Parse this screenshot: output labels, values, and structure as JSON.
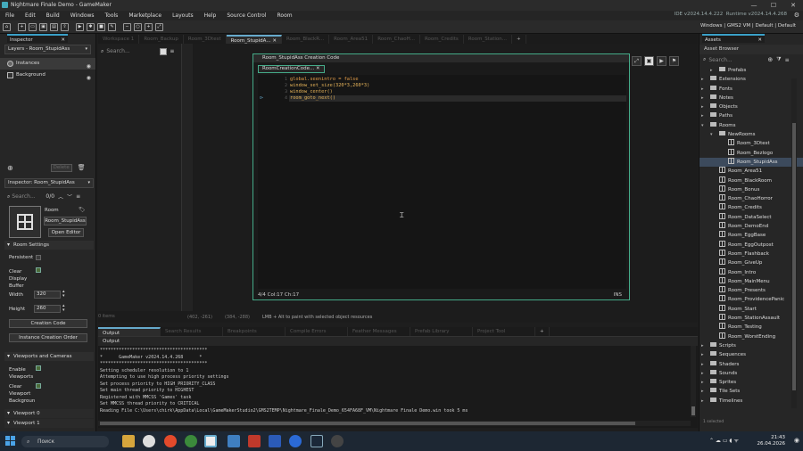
{
  "window": {
    "title": "Nightmare Finale Demo - GameMaker",
    "ide_version": "IDE v2024.14.4.222",
    "runtime_version": "Runtime v2024.14.4.268"
  },
  "menu": [
    "File",
    "Edit",
    "Build",
    "Windows",
    "Tools",
    "Marketplace",
    "Layouts",
    "Help",
    "Source Control",
    "Room"
  ],
  "toolbar": {
    "target": "Windows | GMS2 VM | Default | Default"
  },
  "inspector": {
    "tab": "Inspector",
    "layers_title": "Layers - Room_StupidAss",
    "layers": [
      "Instances",
      "Background"
    ],
    "delete_label": "Delete",
    "inspector_select": "Inspector: Room_StupidAss",
    "search_placeholder": "Search...",
    "search_count": "0/0",
    "room_label": "Room",
    "room_name": "Room_StupidAss",
    "open_editor": "Open Editor",
    "room_settings": "Room Settings",
    "persistent": "Persistent",
    "clear_display_buffer": "Clear Display Buffer",
    "width_label": "Width",
    "width_value": "320",
    "height_label": "Height",
    "height_value": "260",
    "creation_code": "Creation Code",
    "instance_creation_order": "Instance Creation Order",
    "viewports": "Viewports and Cameras",
    "enable_viewports": "Enable Viewports",
    "clear_viewport_bg": "Clear Viewport Backgroun",
    "viewport0": "Viewport 0",
    "viewport1": "Viewport 1"
  },
  "editor_tabs": [
    "Workspace 1",
    "Room_Backup",
    "Room_3Dtest",
    "Room_StupidA...",
    "Room_BlackR...",
    "Room_Area51",
    "Room_ChaoH...",
    "Room_Credits",
    "Room_Station..."
  ],
  "room_tree": {
    "search_placeholder": "Search...",
    "instances": "0 items"
  },
  "code_editor": {
    "window_title": "Room_StupidAss Creation Code",
    "tab": "RoomCreationCode...",
    "lines": [
      "global.seenintro = false",
      "window_set_size(320*3,260*3)",
      "window_center()",
      "room_goto_next()"
    ],
    "status_pos": "4/4 Col:17 Ch:17",
    "status_mode": "INS"
  },
  "workspace_status": {
    "mouse": "(402, -261)",
    "grid": "(384, -288)",
    "hint": "LMB + Alt to paint with selected object resources"
  },
  "output_tabs": [
    "Output",
    "Search Results",
    "Breakpoints",
    "Compile Errors",
    "Feather Messages",
    "Prefab Library",
    "Project Tool"
  ],
  "output": {
    "header": "Output",
    "lines": [
      "****************************************",
      "*      GameMaker v2024.14.4.268      *",
      "****************************************",
      "Setting scheduler resolution to 1",
      "Attempting to use high process priority settings",
      "Set process priority to HIGH_PRIORITY_CLASS",
      "Set main thread priority to HIGHEST",
      "Registered with MMCSS 'Games' task",
      "Set MMCSS thread priority to CRITICAL",
      "Reading File C:\\Users\\chirk\\AppData\\Local\\GameMakerStudio2\\GMS2TEMP\\Nightmare_Finale_Demo_654FA68F_VM\\Nightmare Finale Demo.win took 5 ms"
    ]
  },
  "assets": {
    "tab": "Assets",
    "title": "Asset Browser",
    "search_placeholder": "Search...",
    "items": [
      {
        "label": "Prefabs",
        "indent": 1,
        "kind": "folder",
        "arrow": "▸"
      },
      {
        "label": "Extensions",
        "indent": 0,
        "kind": "folder",
        "arrow": "▸"
      },
      {
        "label": "Fonts",
        "indent": 0,
        "kind": "folder",
        "arrow": "▸"
      },
      {
        "label": "Notes",
        "indent": 0,
        "kind": "folder",
        "arrow": "▸"
      },
      {
        "label": "Objects",
        "indent": 0,
        "kind": "folder",
        "arrow": "▸"
      },
      {
        "label": "Paths",
        "indent": 0,
        "kind": "folder",
        "arrow": "▸"
      },
      {
        "label": "Rooms",
        "indent": 0,
        "kind": "folder",
        "arrow": "▾"
      },
      {
        "label": "NewRooms",
        "indent": 1,
        "kind": "folder",
        "arrow": "▾"
      },
      {
        "label": "Room_3Dtest",
        "indent": 2,
        "kind": "room",
        "arrow": ""
      },
      {
        "label": "Room_Bezlogo",
        "indent": 2,
        "kind": "room",
        "arrow": ""
      },
      {
        "label": "Room_StupidAss",
        "indent": 2,
        "kind": "room",
        "arrow": "",
        "selected": true
      },
      {
        "label": "Room_Area51",
        "indent": 1,
        "kind": "room",
        "arrow": ""
      },
      {
        "label": "Room_BlackRoom",
        "indent": 1,
        "kind": "room",
        "arrow": ""
      },
      {
        "label": "Room_Bonus",
        "indent": 1,
        "kind": "room",
        "arrow": ""
      },
      {
        "label": "Room_ChaoHorror",
        "indent": 1,
        "kind": "room",
        "arrow": ""
      },
      {
        "label": "Room_Credits",
        "indent": 1,
        "kind": "room",
        "arrow": ""
      },
      {
        "label": "Room_DataSelect",
        "indent": 1,
        "kind": "room",
        "arrow": ""
      },
      {
        "label": "Room_DemoEnd",
        "indent": 1,
        "kind": "room",
        "arrow": ""
      },
      {
        "label": "Room_EggBase",
        "indent": 1,
        "kind": "room",
        "arrow": ""
      },
      {
        "label": "Room_EggOutpost",
        "indent": 1,
        "kind": "room",
        "arrow": ""
      },
      {
        "label": "Room_Flashback",
        "indent": 1,
        "kind": "room",
        "arrow": ""
      },
      {
        "label": "Room_GiveUp",
        "indent": 1,
        "kind": "room",
        "arrow": ""
      },
      {
        "label": "Room_Intro",
        "indent": 1,
        "kind": "room",
        "arrow": ""
      },
      {
        "label": "Room_MainMenu",
        "indent": 1,
        "kind": "room",
        "arrow": ""
      },
      {
        "label": "Room_Presents",
        "indent": 1,
        "kind": "room",
        "arrow": ""
      },
      {
        "label": "Room_ProvidencePanic",
        "indent": 1,
        "kind": "room",
        "arrow": ""
      },
      {
        "label": "Room_Start",
        "indent": 1,
        "kind": "room",
        "arrow": ""
      },
      {
        "label": "Room_StationAssault",
        "indent": 1,
        "kind": "room",
        "arrow": ""
      },
      {
        "label": "Room_Testing",
        "indent": 1,
        "kind": "room",
        "arrow": ""
      },
      {
        "label": "Room_WorstEnding",
        "indent": 1,
        "kind": "room",
        "arrow": ""
      },
      {
        "label": "Scripts",
        "indent": 0,
        "kind": "folder",
        "arrow": "▸"
      },
      {
        "label": "Sequences",
        "indent": 0,
        "kind": "folder",
        "arrow": "▸"
      },
      {
        "label": "Shaders",
        "indent": 0,
        "kind": "folder",
        "arrow": "▸"
      },
      {
        "label": "Sounds",
        "indent": 0,
        "kind": "folder",
        "arrow": "▸"
      },
      {
        "label": "Sprites",
        "indent": 0,
        "kind": "folder",
        "arrow": "▸"
      },
      {
        "label": "Tile Sets",
        "indent": 0,
        "kind": "folder",
        "arrow": "▸"
      },
      {
        "label": "Timelines",
        "indent": 0,
        "kind": "folder",
        "arrow": "▸"
      }
    ],
    "footer": "1 selected"
  },
  "taskbar": {
    "search": "Поиск",
    "time": "21:43",
    "date": "26.04.2026"
  }
}
